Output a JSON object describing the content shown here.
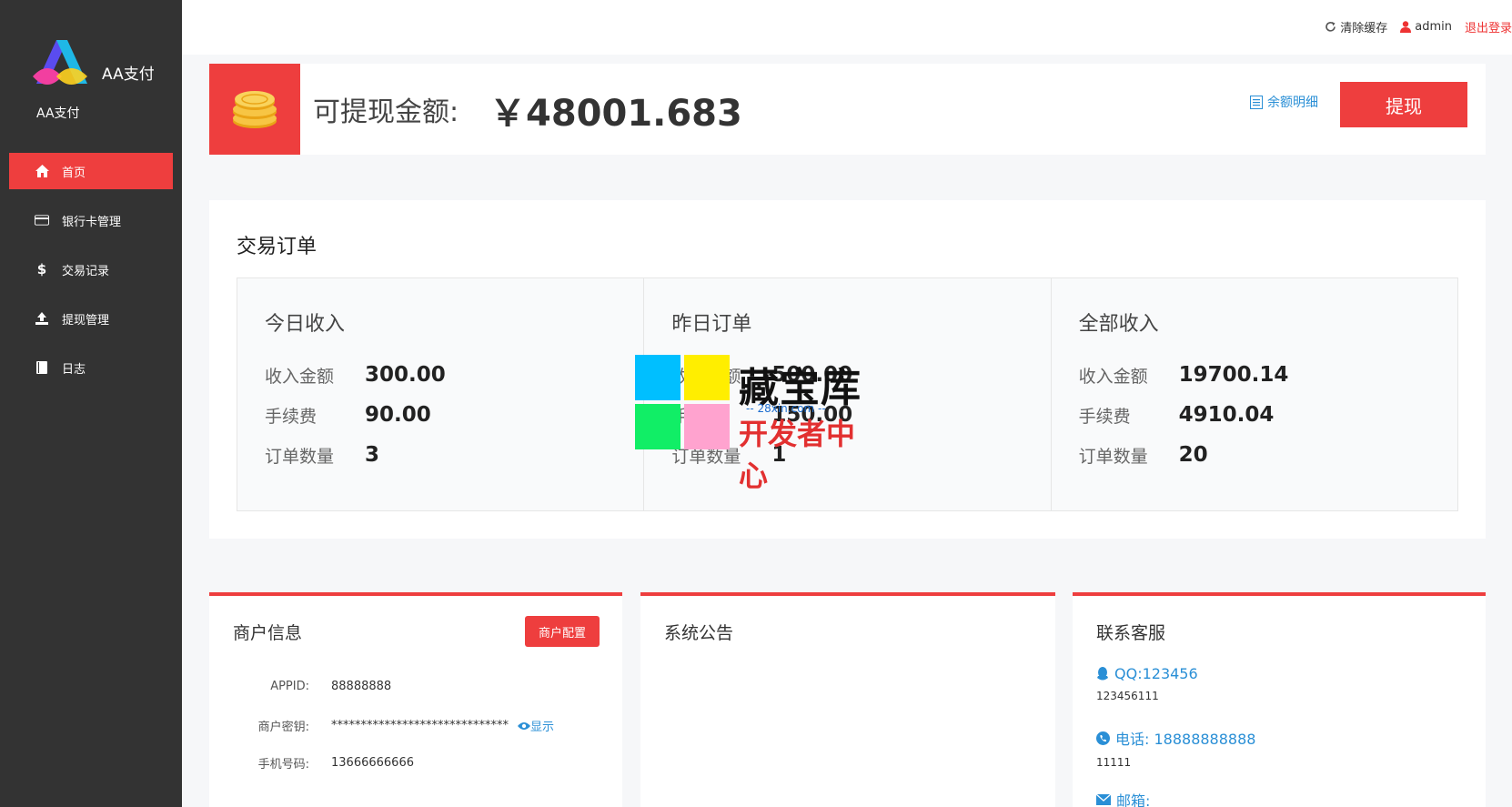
{
  "brand": {
    "name": "AA支付",
    "subtitle": "AA支付"
  },
  "sidebar": {
    "items": [
      {
        "label": "首页",
        "icon": "home-icon",
        "active": true
      },
      {
        "label": "银行卡管理",
        "icon": "card-icon",
        "active": false
      },
      {
        "label": "交易记录",
        "icon": "dollar-icon",
        "active": false
      },
      {
        "label": "提现管理",
        "icon": "upload-icon",
        "active": false
      },
      {
        "label": "日志",
        "icon": "book-icon",
        "active": false
      }
    ]
  },
  "topbar": {
    "clear_cache": "清除缓存",
    "user": "admin",
    "logout": "退出登录"
  },
  "balance": {
    "label": "可提现金额:",
    "value": "￥48001.683",
    "detail_link": "余额明细",
    "withdraw_button": "提现"
  },
  "orders": {
    "title": "交易订单",
    "stats": [
      {
        "title": "今日收入",
        "rows": [
          {
            "key": "收入金额",
            "value": "300.00"
          },
          {
            "key": "手续费",
            "value": "90.00"
          },
          {
            "key": "订单数量",
            "value": "3"
          }
        ]
      },
      {
        "title": "昨日订单",
        "rows": [
          {
            "key": "收入金额",
            "value": "500.00"
          },
          {
            "key": "手续费",
            "value": "150.00"
          },
          {
            "key": "订单数量",
            "value": "1"
          }
        ]
      },
      {
        "title": "全部收入",
        "rows": [
          {
            "key": "收入金额",
            "value": "19700.14"
          },
          {
            "key": "手续费",
            "value": "4910.04"
          },
          {
            "key": "订单数量",
            "value": "20"
          }
        ]
      }
    ]
  },
  "merchant": {
    "title": "商户信息",
    "config_button": "商户配置",
    "appid_label": "APPID:",
    "appid": "88888888",
    "key_label": "商户密钥:",
    "key": "******************************",
    "show_link": "显示",
    "phone_label": "手机号码:",
    "phone": "13666666666"
  },
  "notice": {
    "title": "系统公告"
  },
  "support": {
    "title": "联系客服",
    "qq": "QQ:123456",
    "qq_sub": "123456111",
    "phone": "电话: 18888888888",
    "phone_sub": "11111",
    "email": "邮箱:"
  },
  "watermark": {
    "title": "藏宝库",
    "url": "-- 28xin.com --",
    "subtitle": "开发者中心"
  },
  "colors": {
    "accent": "#ee3e3e",
    "sidebar": "#333333",
    "link": "#2a8fd6"
  }
}
